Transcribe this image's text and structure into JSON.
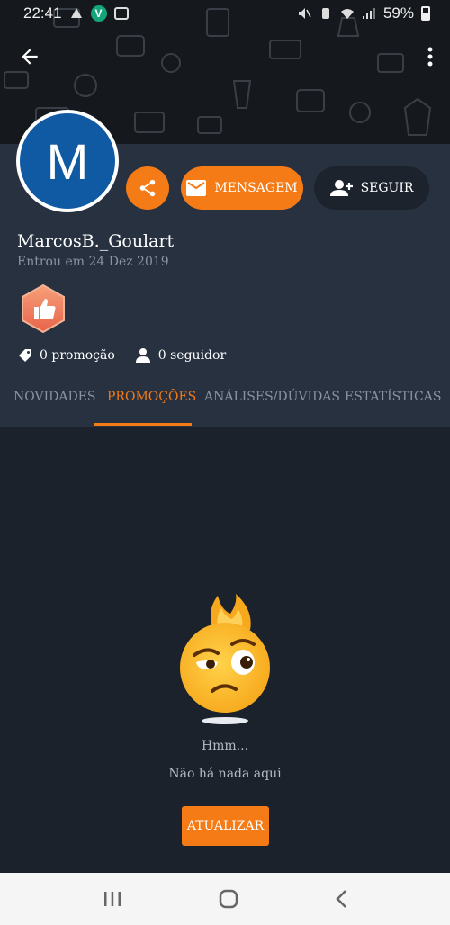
{
  "status_bar": {
    "time": "22:41",
    "v_badge": "V",
    "battery": "59%"
  },
  "profile": {
    "avatar_initial": "M",
    "username": "MarcosB._Goulart",
    "joined": "Entrou em 24 Dez 2019",
    "message_label": "MENSAGEM",
    "follow_label": "SEGUIR",
    "promotions_count": "0 promoção",
    "followers_count": "0 seguidor"
  },
  "tabs": [
    {
      "label": "NOVIDADES"
    },
    {
      "label": "PROMOÇÕES"
    },
    {
      "label": "ANÁLISES/DÚVIDAS"
    },
    {
      "label": "ESTATÍSTICAS"
    }
  ],
  "empty_state": {
    "title": "Hmm...",
    "message": "Não há nada aqui",
    "button": "ATUALIZAR"
  },
  "colors": {
    "accent": "#f57b16",
    "profile_bg": "#273140",
    "content_bg": "#1c222b",
    "avatar_bg": "#0f5aa3"
  },
  "icons": [
    "back-arrow-icon",
    "more-vert-icon",
    "share-icon",
    "mail-icon",
    "person-add-icon",
    "tag-icon",
    "person-icon",
    "thumbs-up-icon",
    "recents-icon",
    "home-icon",
    "back-nav-icon"
  ]
}
